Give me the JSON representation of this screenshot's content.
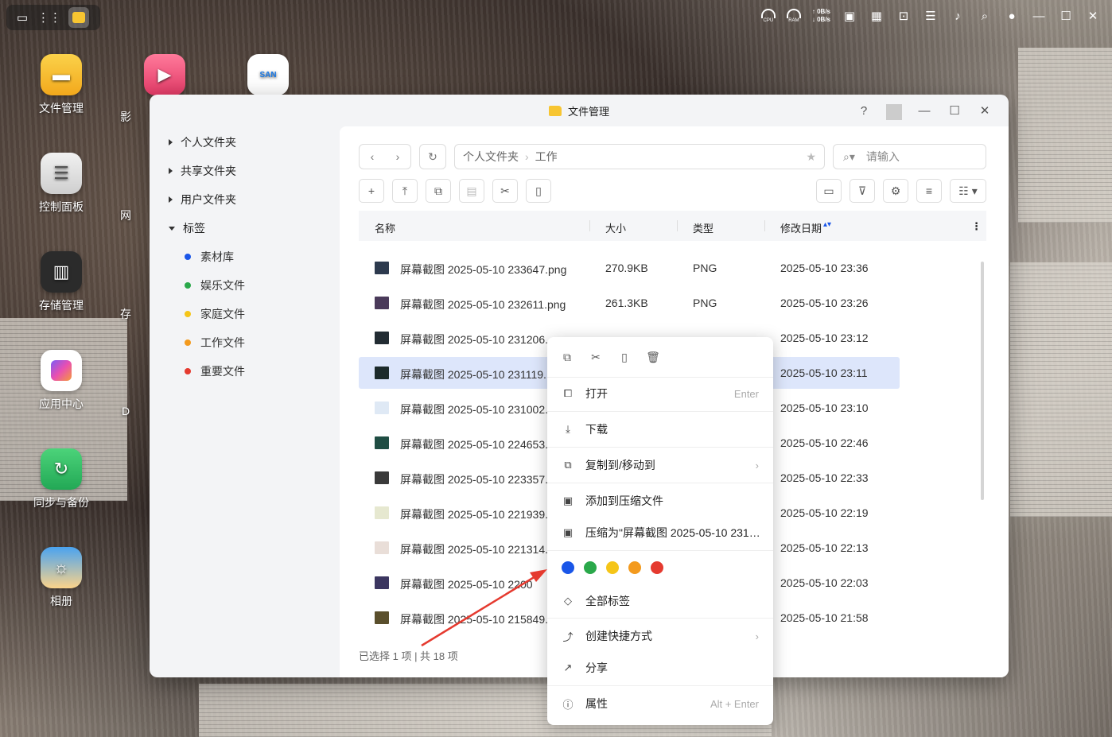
{
  "topbar": {
    "meters": [
      "CPU",
      "RAM"
    ],
    "net_up": "0B/s",
    "net_down": "0B/s"
  },
  "desktop": {
    "icons": [
      "文件管理",
      "控制面板",
      "存储管理",
      "应用中心",
      "同步与备份",
      "相册"
    ],
    "partial_labels": [
      "影",
      "网",
      "存",
      "D"
    ],
    "san_label": "SAN"
  },
  "window": {
    "title": "文件管理",
    "help": "?"
  },
  "sidebar": {
    "items": [
      "个人文件夹",
      "共享文件夹",
      "用户文件夹",
      "标签"
    ],
    "tags": [
      {
        "label": "素材库",
        "color": "#1a56e8"
      },
      {
        "label": "娱乐文件",
        "color": "#2aa84a"
      },
      {
        "label": "家庭文件",
        "color": "#f5c518"
      },
      {
        "label": "工作文件",
        "color": "#f39a1e"
      },
      {
        "label": "重要文件",
        "color": "#e53a2f"
      }
    ]
  },
  "breadcrumb": [
    "个人文件夹",
    "工作"
  ],
  "search": {
    "placeholder": "请输入"
  },
  "columns": {
    "name": "名称",
    "size": "大小",
    "type": "类型",
    "date": "修改日期"
  },
  "files": [
    {
      "name": "屏幕截图 2025-05-10 233647.png",
      "size": "270.9KB",
      "type": "PNG",
      "date": "2025-05-10 23:36",
      "thumb": "#2d3a4e"
    },
    {
      "name": "屏幕截图 2025-05-10 232611.png",
      "size": "261.3KB",
      "type": "PNG",
      "date": "2025-05-10 23:26",
      "thumb": "#4a3a5a"
    },
    {
      "name": "屏幕截图 2025-05-10 231206.",
      "size": "",
      "type": "",
      "date": "2025-05-10 23:12",
      "thumb": "#222c33"
    },
    {
      "name": "屏幕截图 2025-05-10 231119.",
      "size": "",
      "type": "",
      "date": "2025-05-10 23:11",
      "thumb": "#1c2a2a"
    },
    {
      "name": "屏幕截图 2025-05-10 231002.",
      "size": "",
      "type": "",
      "date": "2025-05-10 23:10",
      "thumb": "#dfe9f5"
    },
    {
      "name": "屏幕截图 2025-05-10 224653.",
      "size": "",
      "type": "",
      "date": "2025-05-10 22:46",
      "thumb": "#1f4d43"
    },
    {
      "name": "屏幕截图 2025-05-10 223357.",
      "size": "",
      "type": "",
      "date": "2025-05-10 22:33",
      "thumb": "#3a3a3a"
    },
    {
      "name": "屏幕截图 2025-05-10 221939.",
      "size": "",
      "type": "",
      "date": "2025-05-10 22:19",
      "thumb": "#e6e8d0"
    },
    {
      "name": "屏幕截图 2025-05-10 221314.",
      "size": "",
      "type": "",
      "date": "2025-05-10 22:13",
      "thumb": "#e9ded8"
    },
    {
      "name": "屏幕截图 2025-05-10 2200",
      "size": "",
      "type": "",
      "date": "2025-05-10 22:03",
      "thumb": "#3b3660"
    },
    {
      "name": "屏幕截图 2025-05-10 215849.",
      "size": "",
      "type": "",
      "date": "2025-05-10 21:58",
      "thumb": "#5a4f2c"
    }
  ],
  "status": "已选择 1 项 | 共 18 项",
  "context_menu": {
    "open": "打开",
    "open_shortcut": "Enter",
    "download": "下载",
    "copy_move": "复制到/移动到",
    "add_archive": "添加到压缩文件",
    "compress_as": "压缩为\"屏幕截图 2025-05-10 231…",
    "tag_colors": [
      "#1a56e8",
      "#2aa84a",
      "#f5c518",
      "#f39a1e",
      "#e53a2f"
    ],
    "all_tags": "全部标签",
    "create_shortcut": "创建快捷方式",
    "share": "分享",
    "properties": "属性",
    "properties_shortcut": "Alt + Enter"
  }
}
